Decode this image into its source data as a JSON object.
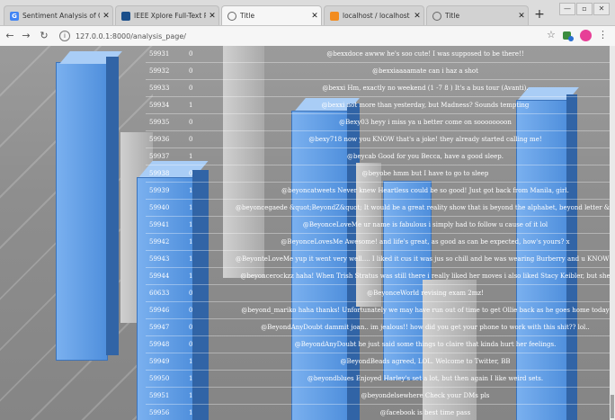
{
  "browser": {
    "tabs": [
      {
        "title": "Sentiment Analysis of Commen",
        "icon": "google-icon",
        "color": "#4285f4",
        "glyph": "G"
      },
      {
        "title": "IEEE Xplore Full-Text PDF:",
        "icon": "ieee-icon",
        "color": "#1b4f8a",
        "glyph": ""
      },
      {
        "title": "Title",
        "icon": "globe-icon",
        "color": "#666666",
        "glyph": ""
      },
      {
        "title": "localhost / localhost | phpMyAd",
        "icon": "phpmyadmin-icon",
        "color": "#f28c1f",
        "glyph": ""
      },
      {
        "title": "Title",
        "icon": "globe-icon",
        "color": "#666666",
        "glyph": ""
      }
    ],
    "url": "127.0.0.1:8000/analysis_page/",
    "new_tab": "+"
  },
  "table": {
    "rows": [
      {
        "id": "59931",
        "label": "0",
        "text": "@bexxdoce awww he's soo cute! I was supposed to be there!!"
      },
      {
        "id": "59932",
        "label": "0",
        "text": "@bexxiaaaamate can i haz a shot"
      },
      {
        "id": "59933",
        "label": "0",
        "text": "@bexxi Hm, exactly no weekend (1 -7 8 ) It's a bus tour (Avanti)."
      },
      {
        "id": "59934",
        "label": "1",
        "text": "@bexxi not more than yesterday, but Madness? Sounds tempting"
      },
      {
        "id": "59935",
        "label": "0",
        "text": "@Bexy03 heyy i miss ya u better come on soooooooon"
      },
      {
        "id": "59936",
        "label": "0",
        "text": "@bexy718 now you KNOW that's a joke! they already started calling me!"
      },
      {
        "id": "59937",
        "label": "1",
        "text": "@beycab Good for you Becca, have a good sleep."
      },
      {
        "id": "59938",
        "label": "0",
        "text": "@beyobe hmm but I have to go to sleep"
      },
      {
        "id": "59939",
        "label": "1",
        "text": "@beyoncatweets Never knew Heartless could be so good! Just got back from Manila, girl."
      },
      {
        "id": "59940",
        "label": "1",
        "text": "@beyoncegaede &quot;BeyondZ&quot; It would be a great reality show that is beyond the alphabet, beyond letter &quot;"
      },
      {
        "id": "59941",
        "label": "1",
        "text": "@BeyonceLoveMe ur name is fabulous i simply had to follow u cause of it lol"
      },
      {
        "id": "59942",
        "label": "1",
        "text": "@BeyonceLovesMe Awesome! and life's great, as good as can be expected, how's yours? x"
      },
      {
        "id": "59943",
        "label": "1",
        "text": "@BeyonteLoveMe yup it went very well.... I liked it cus it was jus so chill and he was wearing Burberry and u KNOW how"
      },
      {
        "id": "59944",
        "label": "1",
        "text": "@beyoncerockzz haha! When Trish Stratus was still there i really liked her moves i also liked Stacy Keibler, but she"
      },
      {
        "id": "60633",
        "label": "0",
        "text": "@BeyonceWorld revising exam 2mz!"
      },
      {
        "id": "59946",
        "label": "0",
        "text": "@beyond_mariko haha thanks! Unfortunately we may have run out of time to get Ollie back as he goes home today"
      },
      {
        "id": "59947",
        "label": "0",
        "text": "@BeyondAnyDoubt dammit joan.. im jealous!! how did you get your phone to work with this shit?? lol.."
      },
      {
        "id": "59948",
        "label": "0",
        "text": "@BeyondAnyDoubt he just said some things to claire that kinda hurt her feelings."
      },
      {
        "id": "59949",
        "label": "1",
        "text": "@BeyondBeads agreed, LOL. Welcome to Twitter, BB"
      },
      {
        "id": "59950",
        "label": "1",
        "text": "@beyondblues Enjoyed Harley's set a lot, but then again I like weird sets."
      },
      {
        "id": "59951",
        "label": "1",
        "text": "@beyondelsewhere Check your DMs pls"
      },
      {
        "id": "59956",
        "label": "1",
        "text": "@facebook is best time pass"
      }
    ]
  }
}
